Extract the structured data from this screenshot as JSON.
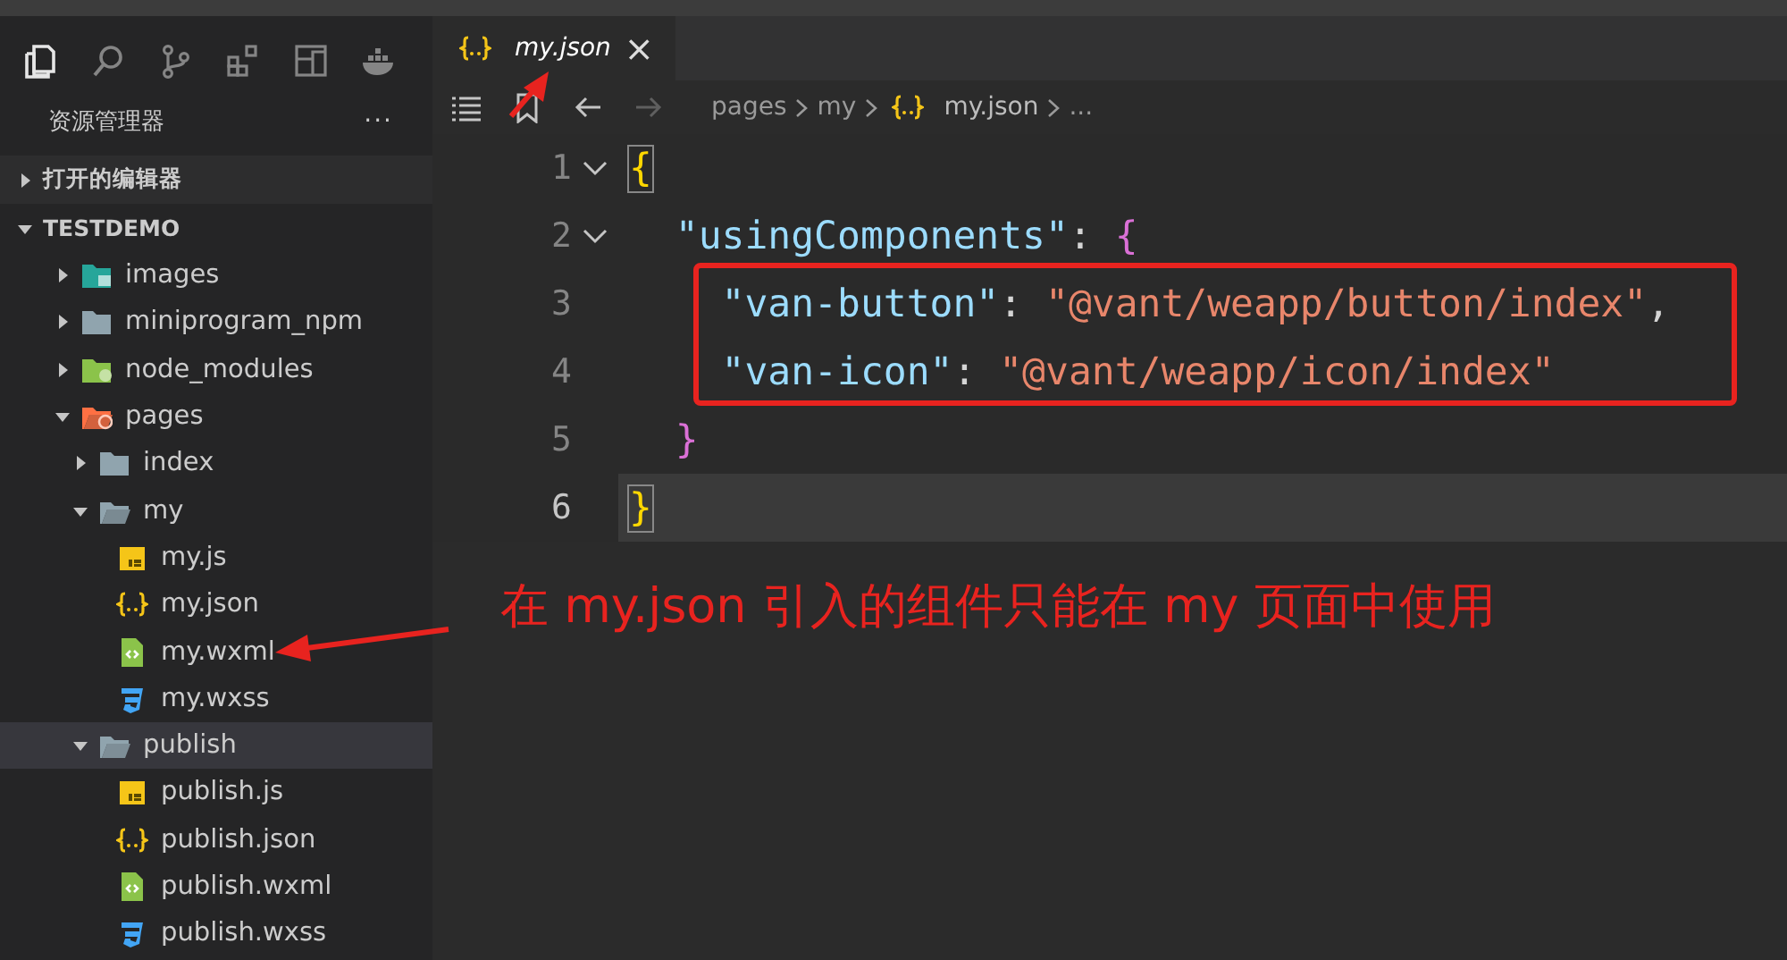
{
  "activity_bar": [
    {
      "kind": "files",
      "selected": true
    },
    {
      "kind": "search",
      "selected": false
    },
    {
      "kind": "branch",
      "selected": false
    },
    {
      "kind": "blocks",
      "selected": false
    },
    {
      "kind": "panel",
      "selected": false
    },
    {
      "kind": "whale",
      "selected": false
    }
  ],
  "sidebar": {
    "title": "资源管理器",
    "more": "···",
    "sections": [
      {
        "label": "打开的编辑器",
        "expanded": false
      },
      {
        "label": "TESTDEMO",
        "expanded": true,
        "children": [
          {
            "label": "images",
            "kind": "folder-images",
            "expanded": false,
            "selected": false
          },
          {
            "label": "miniprogram_npm",
            "kind": "folder",
            "expanded": false,
            "selected": false
          },
          {
            "label": "node_modules",
            "kind": "folder-node",
            "expanded": false,
            "selected": false
          },
          {
            "label": "pages",
            "kind": "folder-pages",
            "expanded": true,
            "selected": false,
            "children": [
              {
                "label": "index",
                "kind": "folder",
                "expanded": false,
                "selected": false
              },
              {
                "label": "my",
                "kind": "folder",
                "expanded": true,
                "selected": false,
                "children": [
                  {
                    "label": "my.js",
                    "kind": "js",
                    "selected": false
                  },
                  {
                    "label": "my.json",
                    "kind": "json",
                    "selected": false
                  },
                  {
                    "label": "my.wxml",
                    "kind": "wxml",
                    "selected": false
                  },
                  {
                    "label": "my.wxss",
                    "kind": "wxss",
                    "selected": false
                  }
                ]
              },
              {
                "label": "publish",
                "kind": "folder",
                "expanded": true,
                "selected": true,
                "children": [
                  {
                    "label": "publish.js",
                    "kind": "js",
                    "selected": false
                  },
                  {
                    "label": "publish.json",
                    "kind": "json",
                    "selected": false
                  },
                  {
                    "label": "publish.wxml",
                    "kind": "wxml",
                    "selected": false
                  },
                  {
                    "label": "publish.wxss",
                    "kind": "wxss",
                    "selected": false
                  }
                ]
              }
            ]
          }
        ]
      }
    ]
  },
  "tabs": [
    {
      "label": "my.json",
      "kind": "json",
      "preview": true,
      "selected": true,
      "close": "×"
    }
  ],
  "breadcrumbs": [
    {
      "label": "pages"
    },
    {
      "label": "my"
    },
    {
      "label": "my.json",
      "kind": "json"
    },
    {
      "label": "..."
    }
  ],
  "editor": {
    "lines": [
      {
        "number": "1",
        "fold": true,
        "current": false,
        "tokens": [
          {
            "text": "{",
            "kind": "brace1",
            "boxed": true
          }
        ]
      },
      {
        "number": "2",
        "fold": true,
        "current": false,
        "tokens": [
          {
            "text": "  \"usingComponents\"",
            "kind": "key"
          },
          {
            "text": ": ",
            "kind": "punct"
          },
          {
            "text": "{",
            "kind": "brace2"
          }
        ]
      },
      {
        "number": "3",
        "fold": false,
        "current": false,
        "tokens": [
          {
            "text": "    \"van-button\"",
            "kind": "key"
          },
          {
            "text": ": ",
            "kind": "punct"
          },
          {
            "text": "\"@vant/weapp/button/index\"",
            "kind": "string"
          },
          {
            "text": ",",
            "kind": "punct"
          }
        ]
      },
      {
        "number": "4",
        "fold": false,
        "current": false,
        "tokens": [
          {
            "text": "    \"van-icon\"",
            "kind": "key"
          },
          {
            "text": ": ",
            "kind": "punct"
          },
          {
            "text": "\"@vant/weapp/icon/index\"",
            "kind": "string"
          }
        ]
      },
      {
        "number": "5",
        "fold": false,
        "current": false,
        "tokens": [
          {
            "text": "  }",
            "kind": "brace2"
          }
        ]
      },
      {
        "number": "6",
        "fold": false,
        "current": true,
        "tokens": [
          {
            "text": "}",
            "kind": "brace1",
            "boxed": true
          }
        ]
      }
    ]
  },
  "annotation": {
    "text": "在 my.json 引入的组件只能在 my 页面中使用"
  }
}
